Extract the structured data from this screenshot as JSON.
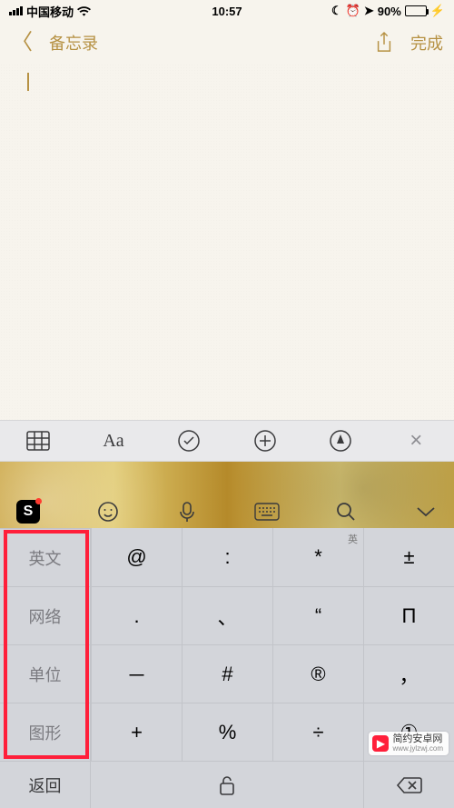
{
  "status": {
    "carrier": "中国移动",
    "time": "10:57",
    "battery_pct": "90%"
  },
  "nav": {
    "back_label": "备忘录",
    "done_label": "完成"
  },
  "notes_toolbar": {
    "aa": "Aa"
  },
  "ime": {
    "categories": [
      "英文",
      "网络",
      "单位",
      "图形"
    ],
    "keys": [
      {
        "main": "@",
        "sup": ""
      },
      {
        "main": ":",
        "sup": ""
      },
      {
        "main": "*",
        "sup": "英"
      },
      {
        "main": "±",
        "sup": ""
      },
      {
        "main": ".",
        "sup": ""
      },
      {
        "main": "、",
        "sup": ""
      },
      {
        "main": "“",
        "sup": ""
      },
      {
        "main": "Π",
        "sup": ""
      },
      {
        "main": "－",
        "sup": ""
      },
      {
        "main": "#",
        "sup": ""
      },
      {
        "main": "®",
        "sup": ""
      },
      {
        "main": "，",
        "sup": ""
      },
      {
        "main": "+",
        "sup": ""
      },
      {
        "main": "%",
        "sup": ""
      },
      {
        "main": "÷",
        "sup": ""
      },
      {
        "main": "①",
        "sup": ""
      }
    ],
    "back_label": "返回"
  },
  "watermark": {
    "title": "简约安卓网",
    "url": "www.jylzwj.com"
  }
}
